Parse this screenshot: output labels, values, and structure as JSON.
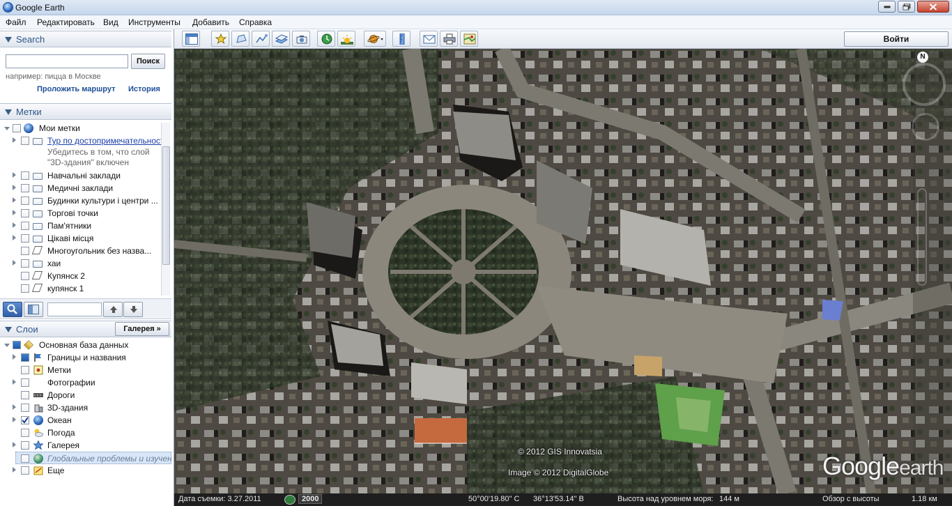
{
  "window": {
    "title": "Google Earth"
  },
  "menu": [
    "Файл",
    "Редактировать",
    "Вид",
    "Инструменты",
    "Добавить",
    "Справка"
  ],
  "search": {
    "header": "Search",
    "button": "Поиск",
    "hint": "например: пицца в Москве",
    "route_link": "Проложить маршрут",
    "history_link": "История",
    "placeholder": ""
  },
  "places": {
    "header": "Метки",
    "items": [
      {
        "label": "Мои метки",
        "icon": "earth-icon"
      },
      {
        "label": "Тур по достопримечательностям",
        "icon": "folder-icon",
        "link": true
      },
      {
        "label": "Убедитесь в том, что слой",
        "icon": "",
        "note": true
      },
      {
        "label": "\"3D-здания\" включен",
        "icon": "",
        "note": true
      },
      {
        "label": "Навчальні заклади",
        "icon": "folder-icon"
      },
      {
        "label": "Медичні заклади",
        "icon": "folder-icon"
      },
      {
        "label": "Будинки культури і центри ...",
        "icon": "folder-icon"
      },
      {
        "label": "Торгові точки",
        "icon": "folder-icon"
      },
      {
        "label": "Пам'ятники",
        "icon": "folder-icon"
      },
      {
        "label": "Цікаві місця",
        "icon": "folder-icon"
      },
      {
        "label": "Многоугольник без назва...",
        "icon": "polygon-icon"
      },
      {
        "label": "хаи",
        "icon": "folder-icon"
      },
      {
        "label": "Купянск 2",
        "icon": "polygon-icon"
      },
      {
        "label": "купянск 1",
        "icon": "polygon-icon"
      }
    ]
  },
  "layers": {
    "header": "Слои",
    "gallery_button": "Галерея »",
    "items": [
      {
        "label": "Основная база данных",
        "checked": "partial"
      },
      {
        "label": "Границы и названия",
        "checked": "partial"
      },
      {
        "label": "Метки",
        "checked": "no"
      },
      {
        "label": "Фотографии",
        "checked": "no"
      },
      {
        "label": "Дороги",
        "checked": "no"
      },
      {
        "label": "3D-здания",
        "checked": "no"
      },
      {
        "label": "Океан",
        "checked": "yes"
      },
      {
        "label": "Погода",
        "checked": "no"
      },
      {
        "label": "Галерея",
        "checked": "no"
      },
      {
        "label": "Глобальные проблемы и изучение",
        "checked": "no",
        "selected": true
      },
      {
        "label": "Еще",
        "checked": "no"
      }
    ]
  },
  "toolbar": {
    "signin": "Войти"
  },
  "map": {
    "copyright1": "© 2012 GIS Innovatsia",
    "copyright2": "Image © 2012 DigitalGlobe",
    "logo_main": "Google",
    "logo_sub": "earth",
    "compass_letter": "N"
  },
  "status": {
    "date": "Дата съемки: 3.27.2011",
    "year": "2000",
    "lat": "50°00'19.80\" С",
    "lon": "36°13'53.14\" В",
    "elev_label": "Высота над уровнем моря:",
    "elev": "144 м",
    "eye_label": "Обзор с высоты",
    "eye": "1.18 км"
  }
}
